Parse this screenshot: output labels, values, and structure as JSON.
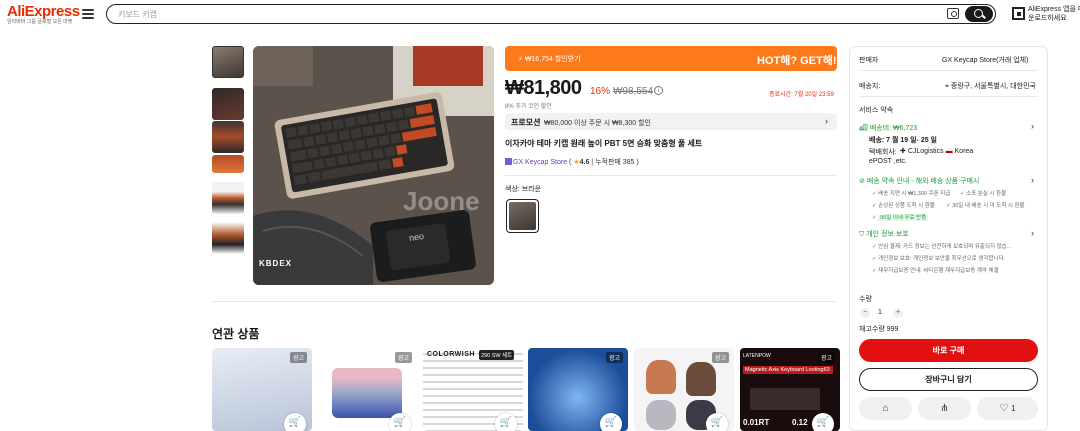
{
  "header": {
    "logo": "AliExpress",
    "logo_sub": "알리바바 그룹 글로벌 오픈 마켓",
    "search_placeholder": "키보드 키캡",
    "app_line1": "AliExpress 앱을 다",
    "app_line2": "운로드하세요"
  },
  "product": {
    "promo_left": "₩16,754 할인받기",
    "promo_right": "HOT해? GET해!",
    "price": "₩81,800",
    "discount": "16%",
    "original_price": "₩98,554",
    "end_time": "종료시간: 7월 20일 23:59",
    "coin_note": "8% 추가 코인 할인",
    "promotion_label": "프로모션",
    "promotion_desc": "₩80,000 이상 주문 시 ₩8,300 할인",
    "title": "이자카야 테마 키캡 원래 높이 PBT 5면 승화 맞춤형 풀 세트",
    "store_name": "GX Keycap Store",
    "rating": "4.6",
    "sold": "누적판매 385",
    "color_label": "색상: 브라운",
    "image_brand": "KBDEX",
    "image_watermark": "Joone",
    "image_neo": "neo"
  },
  "related": {
    "title": "연관 상품",
    "ad": "광고",
    "card_colorwish": "COLORWISH",
    "card_colorwish_badge": "290 SW 세트",
    "card_latenpow": "LATENPOW",
    "card_latenpow_desc": "Magnetic Axis Keyboard Looting63",
    "card_latenpow_val1": "0.01RT",
    "card_latenpow_val2": "0.12"
  },
  "panel": {
    "seller_label": "판매자",
    "seller_value": "GX Keycap Store(거래 업체)",
    "ship_to_label": "배송지:",
    "ship_to_value": "중랑구, 서울특별시, 대한민국",
    "service_title": "서비스 약속",
    "ship_fee": "배송비: ₩6,723",
    "ship_date": "배송: 7 월 19 일- 25 일",
    "courier_label": "택배회사:",
    "courier_name": "CJLogistics",
    "courier_country": "Korea",
    "courier_more": "ePOST ,etc.",
    "promise_title": "배송 약속 안내 - 해외 배송 상품 구매시",
    "promise_1": "배송 지연 시 ₩1,300 쿠폰 지급",
    "promise_2": "소포 분실 시 환불",
    "promise_3": "손상된 상품 도착 시 환불",
    "promise_4": "30일 내 배송 시 미 도착 시 환불",
    "promise_5": "90일 이내 무료 반품",
    "privacy_title": "개인 정보 보호",
    "privacy_1": "안심 결제: 카드 정보는 안전하게 보호되며 유출되지 않습...",
    "privacy_2": "개인정보 보호: 개인정보 보안을 최우선으로 생각합니다.",
    "privacy_3": "재무지급보증 안내: 씨티은행 재무지급보증 계약 체결",
    "qty_label": "수량",
    "qty_value": "1",
    "stock": "재고수량 999",
    "buy_now": "바로 구매",
    "add_cart": "장바구니 담기",
    "like_count": "1"
  }
}
